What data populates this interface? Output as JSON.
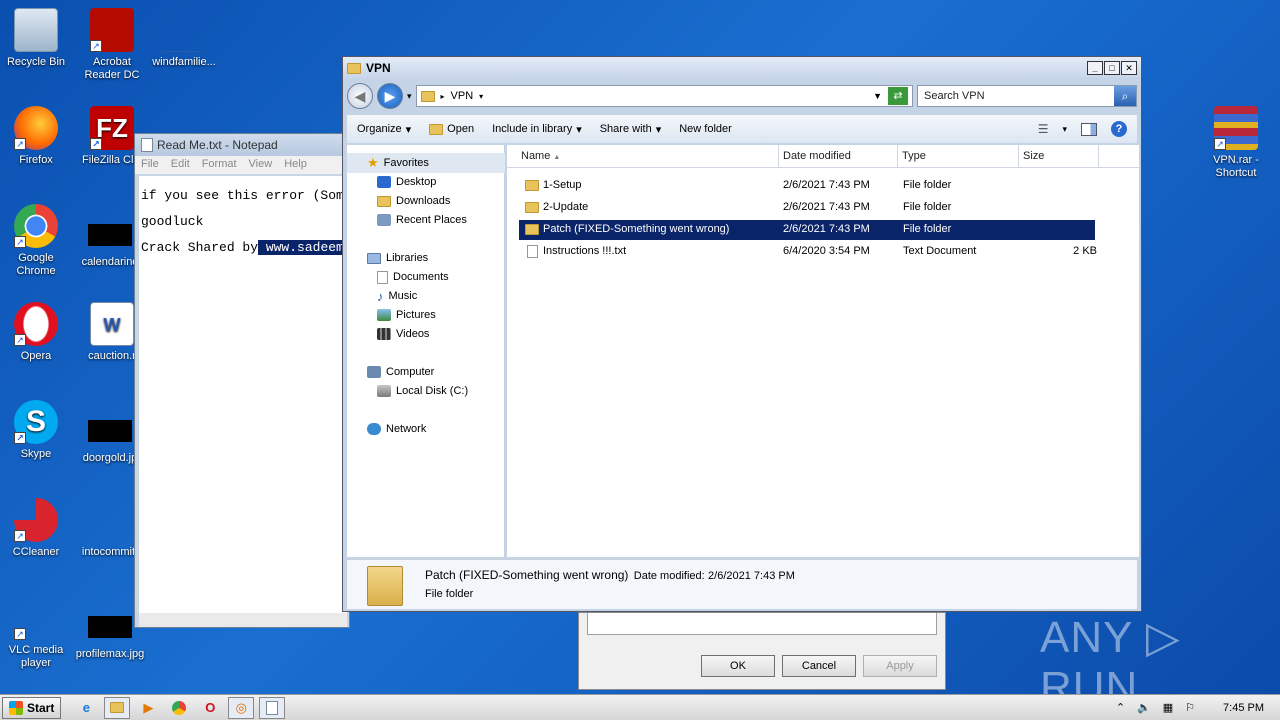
{
  "desktop": {
    "icons": [
      {
        "label": "Recycle Bin"
      },
      {
        "label": "Acrobat Reader DC"
      },
      {
        "label": "windfamilie..."
      },
      {
        "label": "Firefox"
      },
      {
        "label": "FileZilla Clie"
      },
      {
        "label": "Google Chrome"
      },
      {
        "label": "calendarind"
      },
      {
        "label": "Opera"
      },
      {
        "label": "cauction.r"
      },
      {
        "label": "Skype"
      },
      {
        "label": "doorgold.jp"
      },
      {
        "label": "CCleaner"
      },
      {
        "label": "intocommitt"
      },
      {
        "label": "VLC media player"
      },
      {
        "label": "profilemax.jpg"
      },
      {
        "label": "VPN.rar - Shortcut"
      }
    ]
  },
  "notepad": {
    "title": "Read Me.txt - Notepad",
    "menu": [
      "File",
      "Edit",
      "Format",
      "View",
      "Help"
    ],
    "lines": {
      "line1": "if you see this error (Som",
      "line2": "goodluck",
      "line3_prefix": "Crack Shared by",
      "line3_selected": " www.sadeem"
    }
  },
  "dialog": {
    "ok": "OK",
    "cancel": "Cancel",
    "apply": "Apply"
  },
  "explorer": {
    "title": "VPN",
    "address": "VPN",
    "search_placeholder": "Search VPN",
    "toolbar": {
      "organize": "Organize",
      "open": "Open",
      "include": "Include in library",
      "share": "Share with",
      "new_folder": "New folder"
    },
    "nav": {
      "favorites": "Favorites",
      "desktop": "Desktop",
      "downloads": "Downloads",
      "recent": "Recent Places",
      "libraries": "Libraries",
      "documents": "Documents",
      "music": "Music",
      "pictures": "Pictures",
      "videos": "Videos",
      "computer": "Computer",
      "local_disk": "Local Disk (C:)",
      "network": "Network"
    },
    "columns": {
      "name": "Name",
      "modified": "Date modified",
      "type": "Type",
      "size": "Size"
    },
    "files": [
      {
        "name": "1-Setup",
        "modified": "2/6/2021 7:43 PM",
        "type": "File folder",
        "size": ""
      },
      {
        "name": "2-Update",
        "modified": "2/6/2021 7:43 PM",
        "type": "File folder",
        "size": ""
      },
      {
        "name": "Patch (FIXED-Something went wrong)",
        "modified": "2/6/2021 7:43 PM",
        "type": "File folder",
        "size": ""
      },
      {
        "name": "Instructions !!!.txt",
        "modified": "6/4/2020 3:54 PM",
        "type": "Text Document",
        "size": "2 KB"
      }
    ],
    "details": {
      "name": "Patch (FIXED-Something went wrong)",
      "modified_label": "Date modified:",
      "modified": "2/6/2021 7:43 PM",
      "type": "File folder"
    }
  },
  "taskbar": {
    "start": "Start",
    "time": "7:45 PM"
  },
  "watermark": "ANY ▷ RUN"
}
